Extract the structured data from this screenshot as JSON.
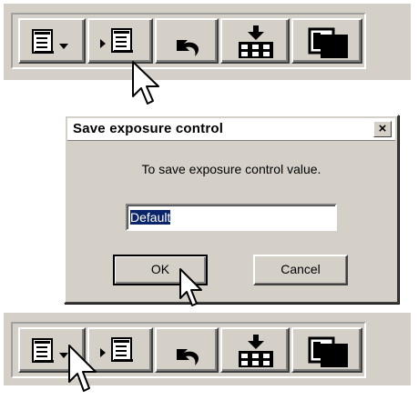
{
  "icons": {
    "toolbar_buttons": [
      "page-dropdown-icon",
      "play-page-icon",
      "undo-icon",
      "load-grid-icon",
      "overlap-squares-icon"
    ],
    "cursor": "arrow-cursor-icon",
    "close": "close-x-icon"
  },
  "dialog": {
    "title": "Save exposure control",
    "close_label": "×",
    "message": "To save exposure control value.",
    "name_value": "Default",
    "ok_label": "OK",
    "cancel_label": "Cancel"
  },
  "colors": {
    "face": "#d4d0c8",
    "selection": "#0a246a"
  }
}
